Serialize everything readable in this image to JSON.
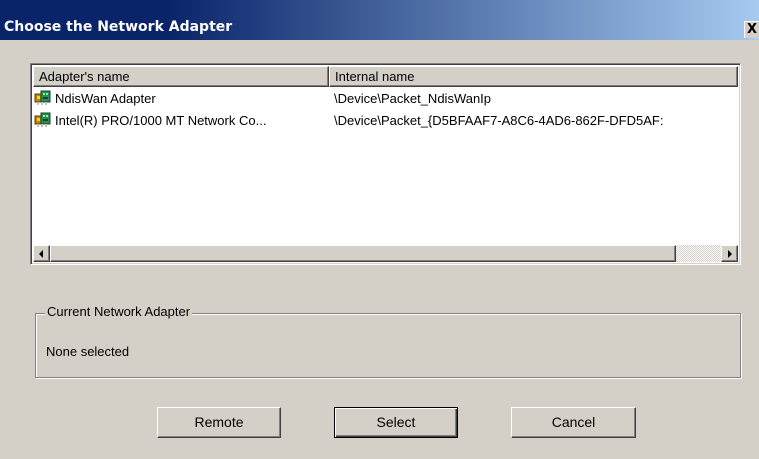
{
  "window": {
    "title": "Choose the Network Adapter",
    "close_label": "X"
  },
  "adapter_list": {
    "columns": [
      "Adapter's name",
      "Internal name"
    ],
    "rows": [
      {
        "icon": "network-adapter-icon",
        "name": "NdisWan Adapter",
        "internal": "\\Device\\Packet_NdisWanIp"
      },
      {
        "icon": "network-adapter-icon",
        "name": "Intel(R) PRO/1000 MT Network Co...",
        "internal": "\\Device\\Packet_{D5BFAAF7-A8C6-4AD6-862F-DFD5AF:"
      }
    ]
  },
  "current_adapter": {
    "label": "Current Network Adapter",
    "value": "None selected"
  },
  "buttons": {
    "remote": "Remote",
    "select": "Select",
    "cancel": "Cancel"
  },
  "colors": {
    "title_gradient_start": "#0a246a",
    "title_gradient_end": "#a6caf0",
    "face": "#d4d0c8"
  }
}
